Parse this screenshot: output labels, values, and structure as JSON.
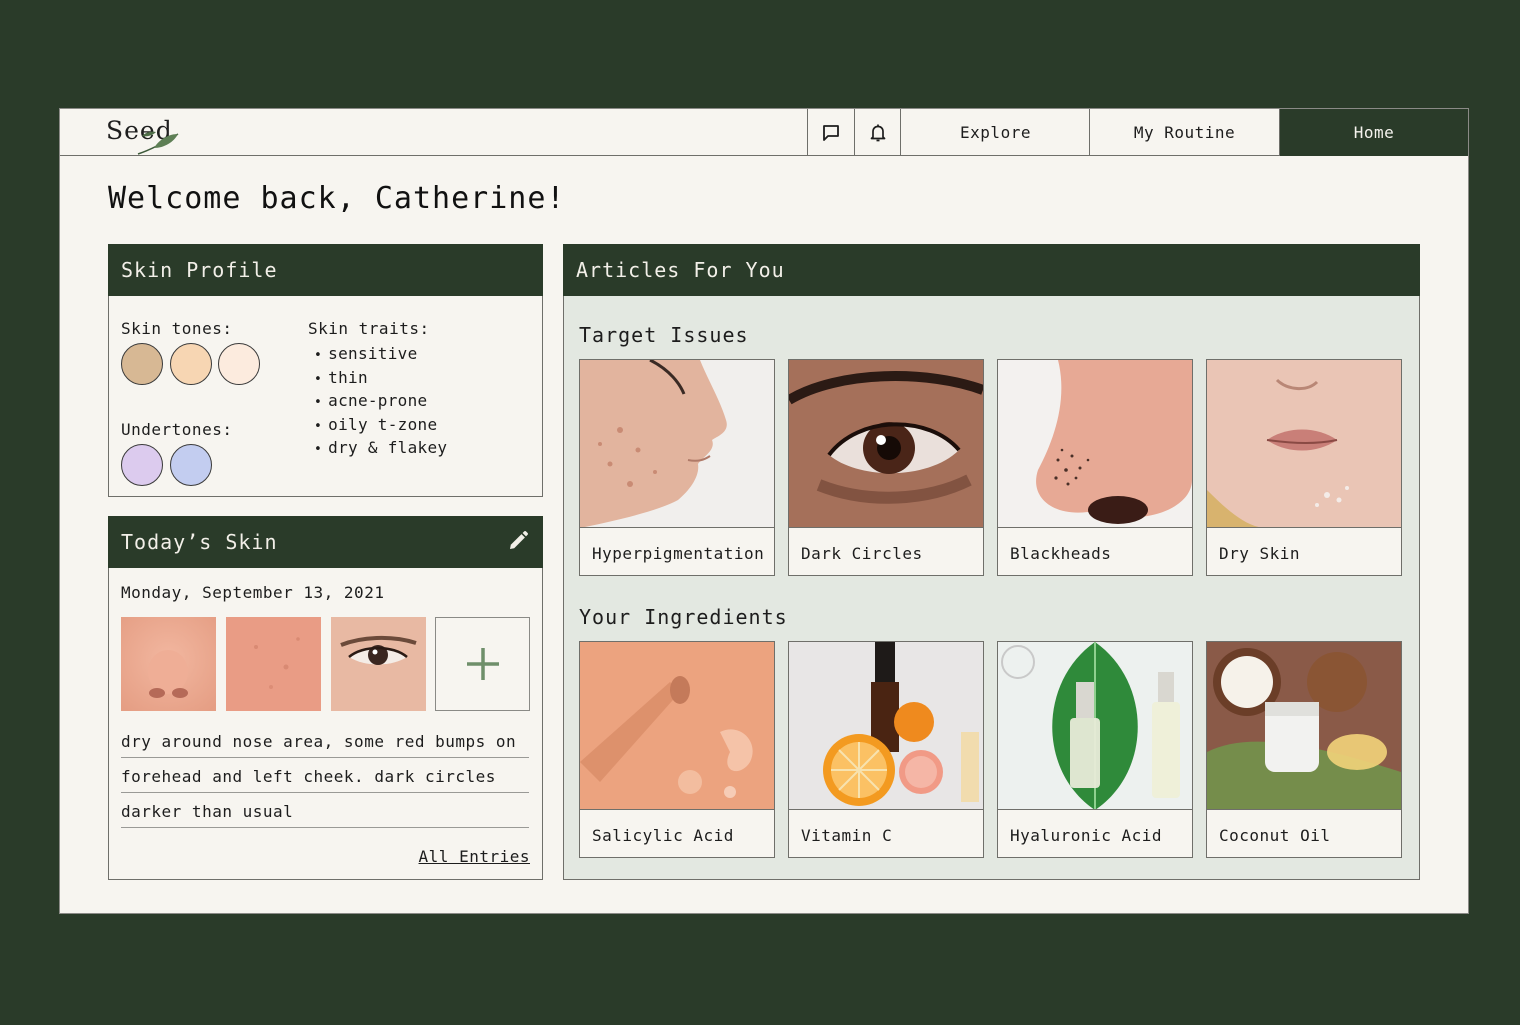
{
  "app": {
    "logo_text": "Seed"
  },
  "nav": {
    "tabs": [
      {
        "label": "Explore"
      },
      {
        "label": "My Routine"
      },
      {
        "label": "Home"
      }
    ],
    "icons": [
      "chat-icon",
      "bell-icon"
    ]
  },
  "welcome": "Welcome back, Catherine!",
  "skin_profile": {
    "title": "Skin Profile",
    "tones_label": "Skin tones:",
    "tones": [
      "#d7b894",
      "#f7d6b3",
      "#fcebde"
    ],
    "undertones_label": "Undertones:",
    "undertones": [
      "#dccbee",
      "#c3cdf0"
    ],
    "traits_label": "Skin traits:",
    "traits": [
      "sensitive",
      "thin",
      "acne-prone",
      "oily t-zone",
      "dry & flakey"
    ]
  },
  "todays_skin": {
    "title": "Today’s Skin",
    "date": "Monday, September 13, 2021",
    "photos": [
      "nose",
      "cheek",
      "eye"
    ],
    "note_lines": [
      "dry around nose area, some red bumps on",
      "forehead and left cheek. dark circles",
      "darker than usual"
    ],
    "all_entries": "All Entries"
  },
  "articles": {
    "title": "Articles For You",
    "target_issues_title": "Target Issues",
    "target_issues": [
      {
        "label": "Hyperpigmentation",
        "image": "face-profile-with-spots"
      },
      {
        "label": "Dark Circles",
        "image": "eye-close-up"
      },
      {
        "label": "Blackheads",
        "image": "nose-close-up"
      },
      {
        "label": "Dry Skin",
        "image": "lips-and-chin"
      }
    ],
    "ingredients_title": "Your Ingredients",
    "ingredients": [
      {
        "label": "Salicylic Acid",
        "image": "serum-dropper"
      },
      {
        "label": "Vitamin C",
        "image": "orange-and-bottle"
      },
      {
        "label": "Hyaluronic Acid",
        "image": "serum-bottles-on-leaf"
      },
      {
        "label": "Coconut Oil",
        "image": "coconut-and-jar"
      }
    ]
  },
  "colors": {
    "brand_dark": "#2a3b29",
    "page_bg": "#f7f5f0",
    "articles_bg": "#e3e8e1"
  }
}
